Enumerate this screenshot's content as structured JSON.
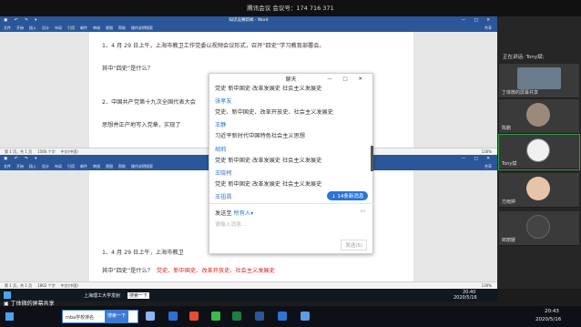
{
  "meeting": {
    "title": "腾讯会议 会议号：174 716 371"
  },
  "word": {
    "title": "知识竞赛新闻 - Word",
    "menu": [
      "文件",
      "开始",
      "插入",
      "设计",
      "布局",
      "引用",
      "邮件",
      "审阅",
      "视图",
      "帮助",
      "操作说明搜索"
    ],
    "share": "共享",
    "status1": [
      "第 1 页，共 1 页",
      "1566 个字",
      "中文(中国)"
    ],
    "status2": [
      "第 1 页，共 1 页",
      "1802 个字",
      "中文(中国)"
    ],
    "zoom": "130%",
    "doc1": [
      "1、4 月 29 日上午，上海市教卫工作党委以视频会议形式，召开“四史”学习教育部署会。",
      "其中“四史”是什么？",
      "2、中国共产党第十九次全国代表大会",
      "思想并正产地写入党章，实现了"
    ],
    "doc2": [
      "1、4 月 29 日上午，上海市教卫",
      "其中“四史”是什么？",
      "党史、新中国史、改革开放史、社会主义发展史"
    ]
  },
  "chat": {
    "title": "聊天",
    "messages": [
      {
        "name": "",
        "text": "党史  新中国史  改革发展史  社会主义发展史"
      },
      {
        "name": "张孝友",
        "text": "党史、新中国史、改革开放史、社会主义发展史"
      },
      {
        "name": "王静",
        "text": "习近平新时代中国特色社会主义思想"
      },
      {
        "name": "胡莉",
        "text": "党史 新中国史 改革发展史 社会主义发展史"
      },
      {
        "name": "王晓柯",
        "text": "党史 新中国史 改革发展史 社会主义发展史"
      },
      {
        "name": "王祖昌",
        "text": "党史 新中国史 改革发展史 社会主义发展史"
      }
    ],
    "new_messages": "14条新消息",
    "send_to_label": "发送至",
    "send_to_value": "所有人",
    "input_placeholder": "请输入消息...",
    "send_button": "发送(S)"
  },
  "panel": {
    "speaking": "正在讲话: Tony斌;",
    "tiles": [
      {
        "name": "丁体微的屏幕共享"
      },
      {
        "name": "陈鹏"
      },
      {
        "name": "Tony斌"
      },
      {
        "name": "方雨婷"
      },
      {
        "name": "郎丽媛"
      }
    ]
  },
  "taskbar1": {
    "items": [
      "上海理工大学发射",
      "搜索一下"
    ],
    "time": "20:40",
    "date": "2020/5/16"
  },
  "share_banner": "丁体微的屏幕共享",
  "taskbar2": {
    "search": "mba学校排名",
    "search_btn": "搜索一下",
    "time": "20:43",
    "date": "2020/5/16"
  },
  "colors": {
    "accent": "#2b579a",
    "name": "#2a74d8",
    "red": "#e02020"
  }
}
